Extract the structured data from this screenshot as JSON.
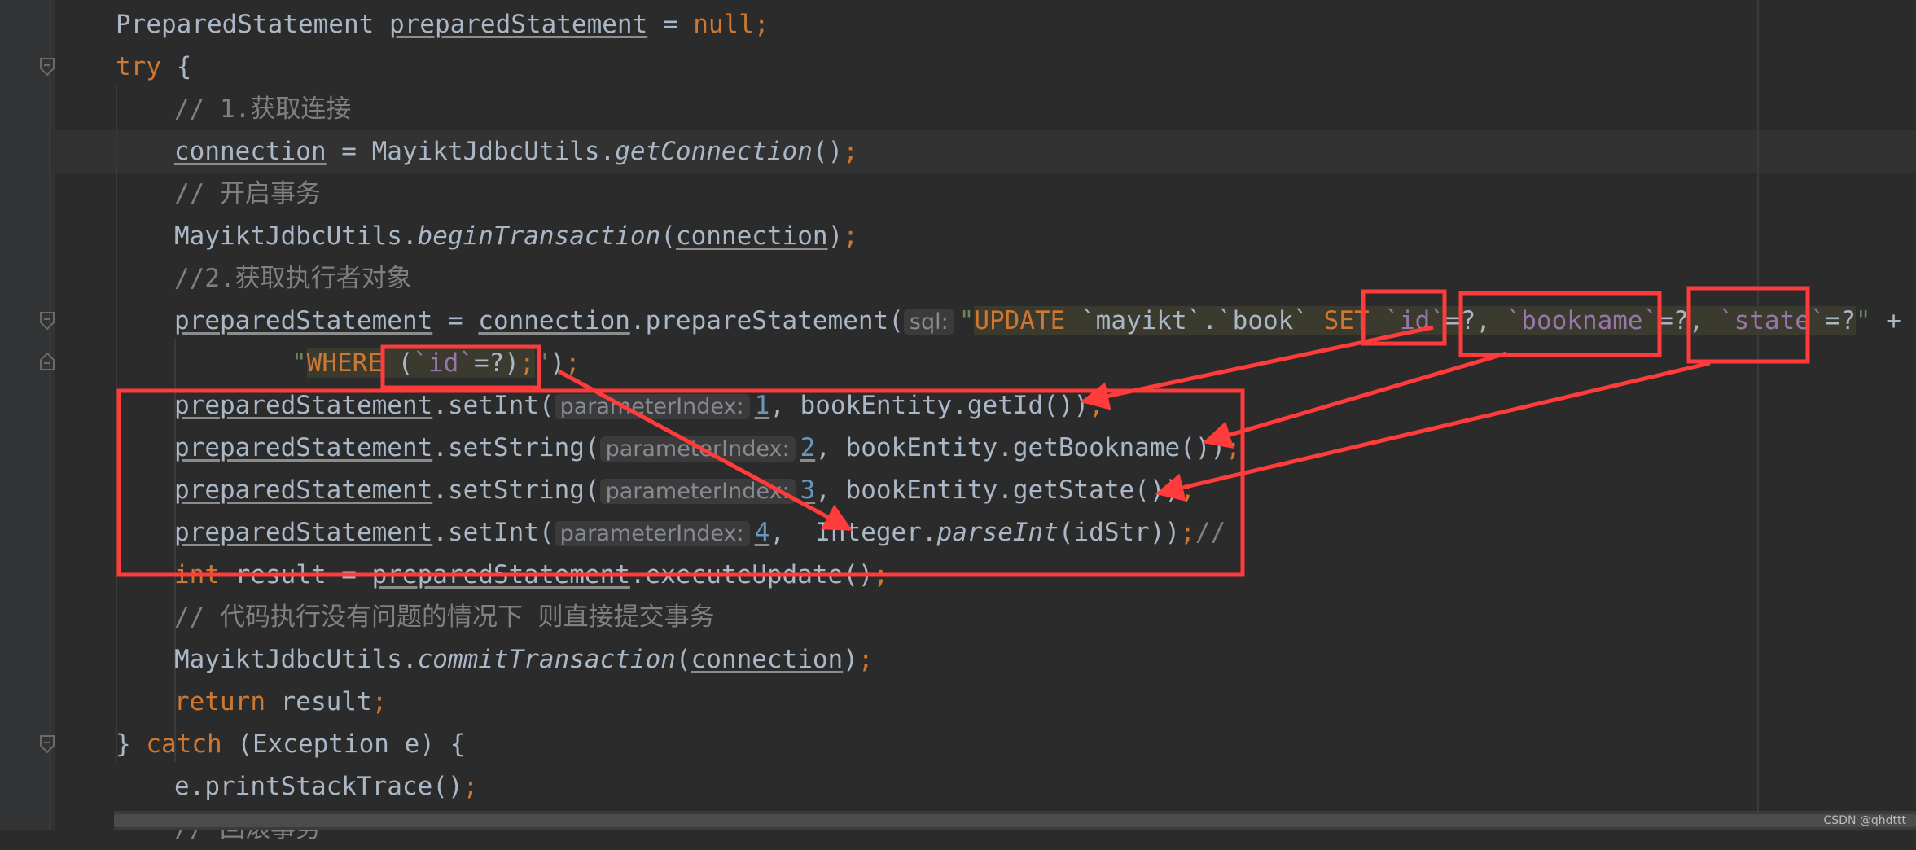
{
  "editor": {
    "lines": {
      "l1": {
        "t1": "PreparedStatement ",
        "t2": "preparedStatement",
        "t3": " = ",
        "t4": "null",
        "t5": ";"
      },
      "l2": {
        "t1": "try",
        "t2": " {"
      },
      "l3": {
        "t1": "// 1.获取连接"
      },
      "l4": {
        "t1": "connection",
        "t2": " = MayiktJdbcUtils.",
        "t3": "getConnection",
        "t4": "()",
        "t5": ";"
      },
      "l5": {
        "t1": "// 开启事务"
      },
      "l6": {
        "t1": "MayiktJdbcUtils.",
        "t2": "beginTransaction",
        "t3": "(",
        "t4": "connection",
        "t5": ")",
        "t6": ";"
      },
      "l7": {
        "t1": "//2.获取执行者对象"
      },
      "l8": {
        "t1": "preparedStatement",
        "t2": " = ",
        "t3": "connection",
        "t4": ".prepareStatement(",
        "hint": "sql:",
        "q": "\"",
        "s1": "UPDATE ",
        "s2": "`mayikt`.`book`",
        "s3": " SET ",
        "s4": "`id`",
        "s5": "=?, ",
        "s6": "`bookname`",
        "s7": "=?, ",
        "s8": "`state`",
        "s9": "=?",
        "q2": "\"",
        "t5": " +"
      },
      "l9": {
        "q": "\"",
        "s1": "WHERE ",
        "s2": "(",
        "s3": "`id`",
        "s4": "=?)",
        "s5": ";",
        "q2": "\"",
        "t1": ")",
        "t2": ";"
      },
      "l10": {
        "t1": "preparedStatement",
        "t2": ".setInt(",
        "hint": "parameterIndex:",
        "n": "1",
        "t3": ", bookEntity.getId())",
        "t4": ";"
      },
      "l11": {
        "t1": "preparedStatement",
        "t2": ".setString(",
        "hint": "parameterIndex:",
        "n": "2",
        "t3": ", bookEntity.getBookname())",
        "t4": ";"
      },
      "l12": {
        "t1": "preparedStatement",
        "t2": ".setString(",
        "hint": "parameterIndex:",
        "n": "3",
        "t3": ", bookEntity.getState())",
        "t4": ";"
      },
      "l13": {
        "t1": "preparedStatement",
        "t2": ".setInt(",
        "hint": "parameterIndex:",
        "n": "4",
        "t3": ",  Integer.",
        "t4": "parseInt",
        "t5": "(idStr))",
        "t6": ";",
        "t7": "//"
      },
      "l14": {
        "t1": "int",
        "t2": " result = ",
        "t3": "preparedStatement",
        "t4": ".executeUpdate()",
        "t5": ";"
      },
      "l15": {
        "t1": "// 代码执行没有问题的情况下 则直接提交事务"
      },
      "l16": {
        "t1": "MayiktJdbcUtils.",
        "t2": "commitTransaction",
        "t3": "(",
        "t4": "connection",
        "t5": ")",
        "t6": ";"
      },
      "l17": {
        "t1": "return",
        "t2": " result",
        "t3": ";"
      },
      "l18": {
        "t1": "} ",
        "t2": "catch",
        "t3": " (Exception e) {"
      },
      "l19": {
        "t1": "e.printStackTrace()",
        "t2": ";"
      },
      "l20": {
        "t1": "// 回滚事务"
      }
    }
  },
  "colors": {
    "background": "#2b2b2b",
    "keyword": "#cc7832",
    "comment": "#808080",
    "number": "#6897bb",
    "string": "#6a8759",
    "sql_identifier": "#9876aa",
    "annotation": "#ff3b3b"
  },
  "watermark": "CSDN @qhdttt"
}
